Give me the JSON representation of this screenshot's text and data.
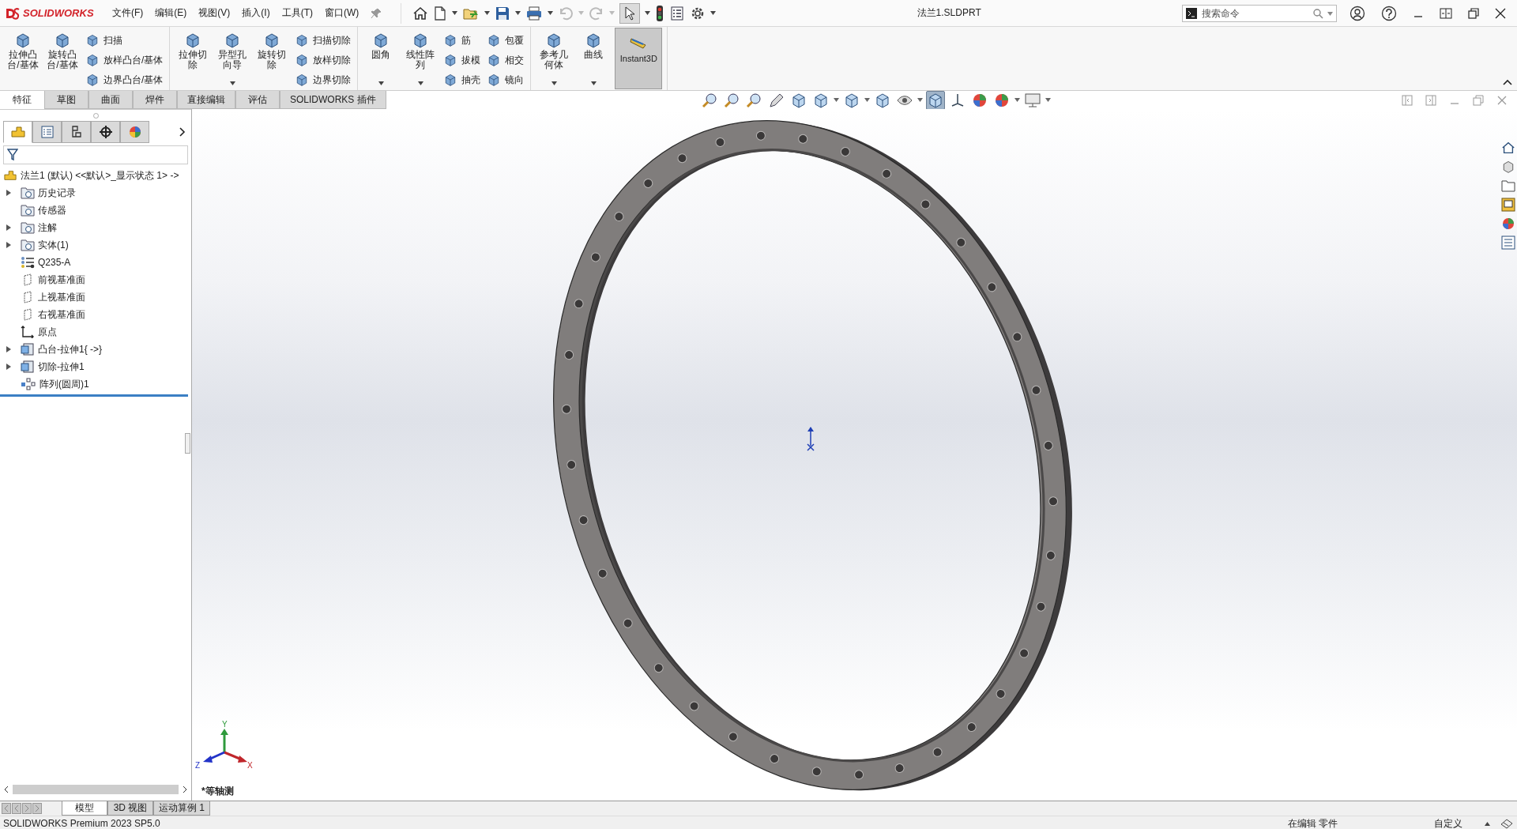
{
  "app": {
    "logo": "SOLIDWORKS",
    "menus": [
      "文件(F)",
      "编辑(E)",
      "视图(V)",
      "插入(I)",
      "工具(T)",
      "窗口(W)"
    ],
    "document_title": "法兰1.SLDPRT",
    "search": {
      "placeholder": "搜索命令"
    }
  },
  "ribbon": {
    "groups": [
      {
        "items": [
          {
            "kind": "large",
            "label": "拉伸凸台/基体",
            "dropdown": false
          },
          {
            "kind": "large",
            "label": "旋转凸台/基体",
            "dropdown": false
          },
          {
            "kind": "column",
            "items": [
              "扫描",
              "放样凸台/基体",
              "边界凸台/基体"
            ]
          }
        ]
      },
      {
        "items": [
          {
            "kind": "large",
            "label": "拉伸切除",
            "dropdown": false
          },
          {
            "kind": "large",
            "label": "异型孔向导",
            "dropdown": true
          },
          {
            "kind": "large",
            "label": "旋转切除",
            "dropdown": false
          },
          {
            "kind": "column",
            "items": [
              "扫描切除",
              "放样切除",
              "边界切除"
            ]
          }
        ]
      },
      {
        "items": [
          {
            "kind": "large",
            "label": "圆角",
            "dropdown": true
          },
          {
            "kind": "large",
            "label": "线性阵列",
            "dropdown": true
          },
          {
            "kind": "column",
            "items": [
              "筋",
              "拔模",
              "抽壳"
            ]
          },
          {
            "kind": "column",
            "items": [
              "包覆",
              "相交",
              "镜向"
            ]
          }
        ]
      },
      {
        "items": [
          {
            "kind": "large",
            "label": "参考几何体",
            "dropdown": true
          },
          {
            "kind": "large",
            "label": "曲线",
            "dropdown": true
          },
          {
            "kind": "toggle",
            "label": "Instant3D",
            "selected": true
          }
        ]
      }
    ]
  },
  "command_tabs": [
    {
      "label": "特征",
      "selected": true
    },
    {
      "label": "草图",
      "selected": false
    },
    {
      "label": "曲面",
      "selected": false
    },
    {
      "label": "焊件",
      "selected": false
    },
    {
      "label": "直接编辑",
      "selected": false
    },
    {
      "label": "评估",
      "selected": false
    },
    {
      "label": "SOLIDWORKS 插件",
      "selected": false
    }
  ],
  "view_toolbar": [
    {
      "selected": false
    },
    {
      "selected": false
    },
    {
      "selected": false
    },
    {
      "selected": false
    },
    {
      "selected": false
    },
    {
      "selected": false
    },
    {
      "selected": false
    },
    {
      "selected": false
    },
    {
      "selected": false
    },
    {
      "selected": true
    },
    {
      "selected": false
    },
    {
      "selected": false
    },
    {
      "selected": false
    },
    {
      "selected": false
    }
  ],
  "panel_tabs": [
    {
      "selected": true
    },
    {
      "selected": false
    },
    {
      "selected": false
    },
    {
      "selected": false
    },
    {
      "selected": false
    }
  ],
  "tree": {
    "root": "法兰1 (默认) <<默认>_显示状态 1> ->",
    "items": [
      {
        "label": "历史记录",
        "kind": "folder",
        "expandable": true
      },
      {
        "label": "传感器",
        "kind": "folder",
        "expandable": false
      },
      {
        "label": "注解",
        "kind": "folder",
        "expandable": true
      },
      {
        "label": "实体(1)",
        "kind": "folder",
        "expandable": true
      },
      {
        "label": "Q235-A",
        "kind": "material",
        "expandable": false
      },
      {
        "label": "前视基准面",
        "kind": "plane",
        "expandable": false
      },
      {
        "label": "上视基准面",
        "kind": "plane",
        "expandable": false
      },
      {
        "label": "右视基准面",
        "kind": "plane",
        "expandable": false
      },
      {
        "label": "原点",
        "kind": "origin",
        "expandable": false
      },
      {
        "label": "凸台-拉伸1{ ->}",
        "kind": "feature",
        "expandable": true
      },
      {
        "label": "切除-拉伸1",
        "kind": "feature",
        "expandable": true
      },
      {
        "label": "阵列(圆周)1",
        "kind": "pattern",
        "expandable": false
      }
    ]
  },
  "viewport": {
    "view_name": "*等轴测",
    "triad": {
      "x": "X",
      "y": "Y",
      "z": "Z"
    }
  },
  "model_tabs": [
    {
      "label": "模型",
      "selected": true
    },
    {
      "label": "3D 视图",
      "selected": false
    },
    {
      "label": "运动算例 1",
      "selected": false
    }
  ],
  "status_bar": {
    "product": "SOLIDWORKS Premium 2023 SP5.0",
    "mode": "在编辑 零件",
    "units": "自定义"
  }
}
